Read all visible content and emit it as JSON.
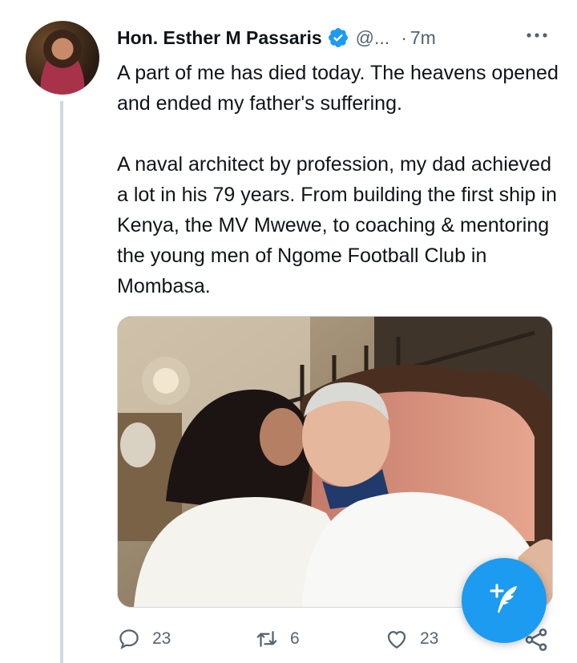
{
  "author": {
    "name": "Hon. Esther M Passaris",
    "handle": "@...",
    "separator": "·",
    "time": "7m",
    "verified": true
  },
  "tweet": {
    "paragraph1": "A part of me has died today. The heavens opened and ended my father's suffering.",
    "paragraph2": "A naval architect by profession, my dad achieved a lot in his 79 years. From building the first ship in Kenya, the MV Mwewe, to coaching & mentoring the young men of Ngome Football Club in Mombasa."
  },
  "actions": {
    "reply_count": "23",
    "retweet_count": "6",
    "like_count": "23"
  },
  "icons": {
    "verified": "verified-badge-icon",
    "more": "more-icon",
    "reply": "reply-icon",
    "retweet": "retweet-icon",
    "like": "heart-icon",
    "share": "share-icon",
    "compose": "compose-tweet-icon"
  },
  "colors": {
    "accent": "#1d9bf0",
    "text": "#0f1419",
    "secondary": "#536471",
    "thread_line": "#cfd9de"
  }
}
